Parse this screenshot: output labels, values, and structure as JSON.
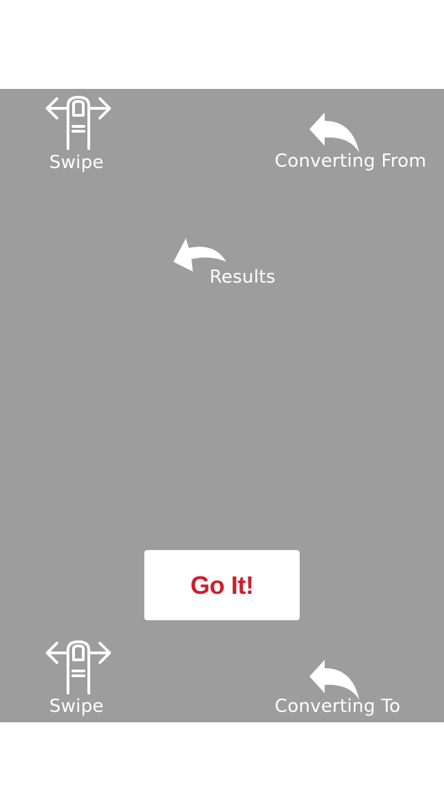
{
  "overlay": {
    "background": "#9c9d9c"
  },
  "hints": {
    "swipe_top_label": "Swipe",
    "converting_from_label": "Converting From",
    "results_label": "Results",
    "swipe_bottom_label": "Swipe",
    "converting_to_label": "Converting To"
  },
  "icons": {
    "swipe": "swipe-gesture-icon",
    "arrow": "curved-arrow-icon"
  },
  "button": {
    "label": "Go It!",
    "text_color": "#cc1f2b",
    "background": "#ffffff"
  }
}
